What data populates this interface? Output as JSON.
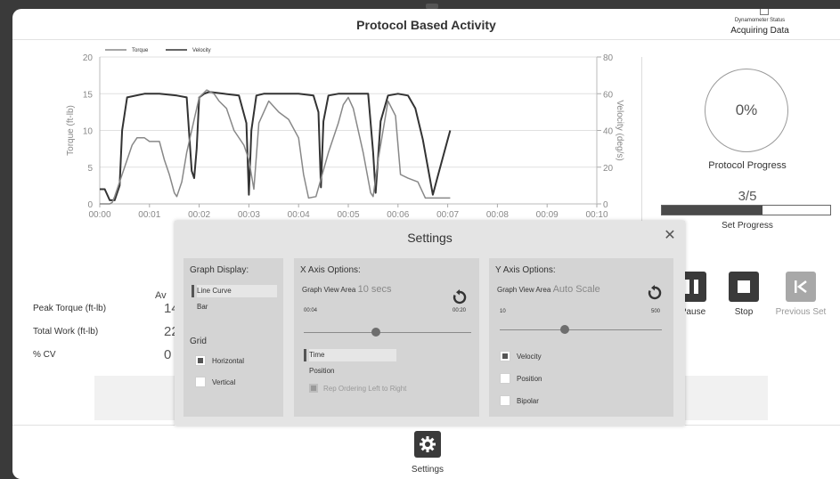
{
  "header": {
    "title": "Protocol Based Activity",
    "status_label": "Dynamometer Status",
    "status_value": "Acquiring Data"
  },
  "chart_data": {
    "type": "line",
    "legend": [
      "Torque",
      "Velocity"
    ],
    "ylabel_left": "Torque (ft-lb)",
    "ylabel_right": "Velocity (deg/s)",
    "ylim_left": [
      0,
      20
    ],
    "ylim_right": [
      0,
      80
    ],
    "yticks_left": [
      "0",
      "5",
      "10",
      "15",
      "20"
    ],
    "yticks_right": [
      "0",
      "20",
      "40",
      "60",
      "80"
    ],
    "xticks": [
      "00:00",
      "00:01",
      "00:02",
      "00:03",
      "00:04",
      "00:05",
      "00:06",
      "00:07",
      "00:08",
      "00:09",
      "00:10"
    ],
    "xlim_seconds": [
      0,
      10
    ],
    "grid": "horizontal",
    "legend_position": "top-left",
    "series": [
      {
        "name": "Velocity",
        "axis": "right",
        "color": "#333333",
        "x": [
          0,
          0.1,
          0.2,
          0.3,
          0.4,
          0.45,
          0.55,
          0.9,
          1.2,
          1.55,
          1.75,
          1.85,
          1.9,
          1.95,
          2.0,
          2.1,
          2.2,
          2.5,
          2.8,
          2.95,
          3.0,
          3.05,
          3.15,
          3.3,
          3.6,
          4.0,
          4.3,
          4.4,
          4.45,
          4.5,
          4.6,
          4.8,
          5.2,
          5.4,
          5.5,
          5.55,
          5.65,
          5.8,
          6.0,
          6.2,
          6.35,
          6.5,
          6.6,
          6.7,
          6.8,
          6.9,
          7.0,
          7.05
        ],
        "y": [
          8,
          8,
          2,
          2,
          10,
          40,
          58,
          60,
          60,
          59,
          58,
          18,
          14,
          30,
          58,
          60,
          61,
          60,
          59,
          44,
          5,
          40,
          59,
          60,
          60,
          60,
          59,
          50,
          9,
          45,
          59,
          60,
          60,
          60,
          28,
          6,
          45,
          59,
          60,
          59,
          52,
          35,
          20,
          5,
          15,
          25,
          35,
          40
        ]
      },
      {
        "name": "Torque",
        "axis": "left",
        "color": "#888888",
        "x": [
          0,
          0.1,
          0.2,
          0.25,
          0.3,
          0.4,
          0.55,
          0.65,
          0.75,
          0.9,
          1.0,
          1.2,
          1.3,
          1.4,
          1.5,
          1.55,
          1.65,
          1.75,
          1.85,
          1.95,
          2.0,
          2.15,
          2.3,
          2.4,
          2.55,
          2.7,
          2.9,
          3.0,
          3.1,
          3.2,
          3.4,
          3.6,
          3.8,
          4.0,
          4.1,
          4.2,
          4.35,
          4.6,
          4.8,
          4.9,
          5.0,
          5.1,
          5.3,
          5.45,
          5.5,
          5.6,
          5.8,
          5.95,
          6.05,
          6.2,
          6.4,
          6.55,
          6.7,
          6.9,
          7.05
        ],
        "y": [
          0,
          0,
          0,
          0.2,
          1,
          3,
          6,
          8,
          9,
          9,
          8.5,
          8.5,
          6,
          4,
          1.5,
          1,
          3,
          7,
          10,
          13,
          14.5,
          15.5,
          15,
          14,
          13,
          10,
          8,
          6,
          2,
          11,
          14,
          12.5,
          11.5,
          9,
          4,
          0.8,
          1,
          7,
          11,
          13.5,
          14.5,
          13,
          7,
          1.5,
          1,
          6,
          14,
          12,
          4,
          3.5,
          3,
          0.8,
          0.8,
          0.8,
          0.8
        ]
      }
    ]
  },
  "progress": {
    "protocol_percent": "0%",
    "protocol_fraction": 0,
    "protocol_label": "Protocol Progress",
    "set_count": "3/5",
    "set_fraction": 0.6,
    "set_label": "Set Progress"
  },
  "metrics": {
    "column_header": "Av",
    "rows": [
      {
        "label": "Peak Torque (ft-lb)",
        "value": "14"
      },
      {
        "label": "Total Work (ft-lb)",
        "value": "22"
      },
      {
        "label": "% CV",
        "value": "0"
      }
    ]
  },
  "actions": {
    "pause_label": "Pause",
    "stop_label": "Stop",
    "previous_set_label": "Previous Set",
    "settings_label": "Settings"
  },
  "modal": {
    "title": "Settings",
    "graph_display": {
      "title": "Graph Display:",
      "options": [
        "Line Curve",
        "Bar"
      ],
      "selected": "Line Curve",
      "grid_title": "Grid",
      "grid_options": [
        {
          "label": "Horizontal",
          "checked": true
        },
        {
          "label": "Vertical",
          "checked": false
        }
      ]
    },
    "x_axis": {
      "title": "X Axis Options:",
      "view_area_label": "Graph View Area",
      "view_area_value": "10 secs",
      "slider_min": "00:04",
      "slider_max": "00:20",
      "slider_fraction": 0.43,
      "mode_options": [
        "Time",
        "Position"
      ],
      "mode_selected": "Time",
      "rep_ordering_label": "Rep Ordering Left to Right",
      "rep_ordering_enabled": false
    },
    "y_axis": {
      "title": "Y Axis Options:",
      "view_area_label": "Graph View Area",
      "view_area_value": "Auto Scale",
      "slider_min": "10",
      "slider_max": "500",
      "slider_fraction": 0.4,
      "options": [
        {
          "label": "Velocity",
          "checked": true
        },
        {
          "label": "Position",
          "checked": false
        },
        {
          "label": "Bipolar",
          "checked": false
        }
      ]
    }
  }
}
